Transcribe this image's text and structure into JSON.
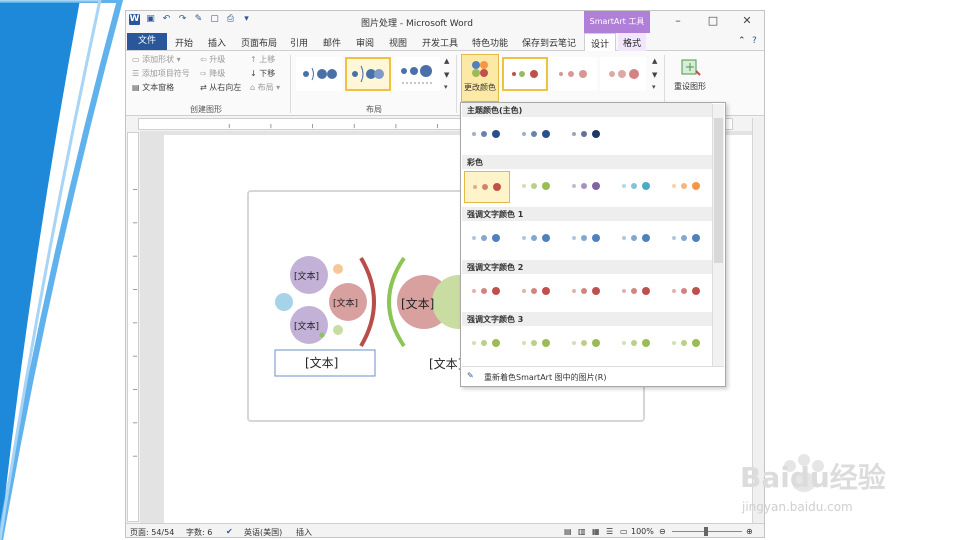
{
  "window": {
    "title": "图片处理 - Microsoft Word",
    "context_tab_group": "SmartArt 工具"
  },
  "tabs": {
    "file": "文件",
    "items": [
      "开始",
      "插入",
      "页面布局",
      "引用",
      "邮件",
      "审阅",
      "视图",
      "开发工具",
      "特色功能",
      "保存到云笔记"
    ],
    "design": "设计",
    "format": "格式"
  },
  "ribbon": {
    "create_graphic": {
      "add_shape": "添加形状",
      "add_bullet": "添加项目符号",
      "text_pane": "文本窗格",
      "promote": "升级",
      "demote": "降级",
      "right_to_left": "从右向左",
      "move_up": "上移",
      "move_down": "下移",
      "layout": "布局",
      "label": "创建图形"
    },
    "layouts_label": "布局",
    "change_colors": "更改颜色",
    "reset_graphic": "重设图形"
  },
  "dropdown": {
    "sections": [
      {
        "title": "主题颜色(主色)",
        "colors": [
          "#2b4f8a",
          "#2b4f8a",
          "#1f3864"
        ]
      },
      {
        "title": "彩色",
        "colors": [
          "#c0504d",
          "#9bbb59",
          "#8064a2",
          "#4bacc6",
          "#f79646"
        ]
      },
      {
        "title": "强调文字颜色 1",
        "colors": [
          "#4f81bd",
          "#4f81bd",
          "#4f81bd",
          "#4f81bd",
          "#4f81bd"
        ]
      },
      {
        "title": "强调文字颜色 2",
        "colors": [
          "#c0504d",
          "#c0504d",
          "#c0504d",
          "#c0504d",
          "#c0504d"
        ]
      },
      {
        "title": "强调文字颜色 3",
        "colors": [
          "#9bbb59",
          "#9bbb59",
          "#9bbb59",
          "#9bbb59",
          "#9bbb59"
        ]
      }
    ],
    "footer": "重新着色SmartArt 图中的图片(R)"
  },
  "document": {
    "placeholders": [
      "[文本]",
      "[文本]",
      "[文本]",
      "[文本]",
      "[文本]",
      "[文本]"
    ]
  },
  "status": {
    "page": "页面: 54/54",
    "words": "字数: 6",
    "language": "英语(美国)",
    "mode": "插入",
    "zoom": "100%"
  },
  "watermark": {
    "brand": "Baidu经验",
    "url": "jingyan.baidu.com"
  }
}
